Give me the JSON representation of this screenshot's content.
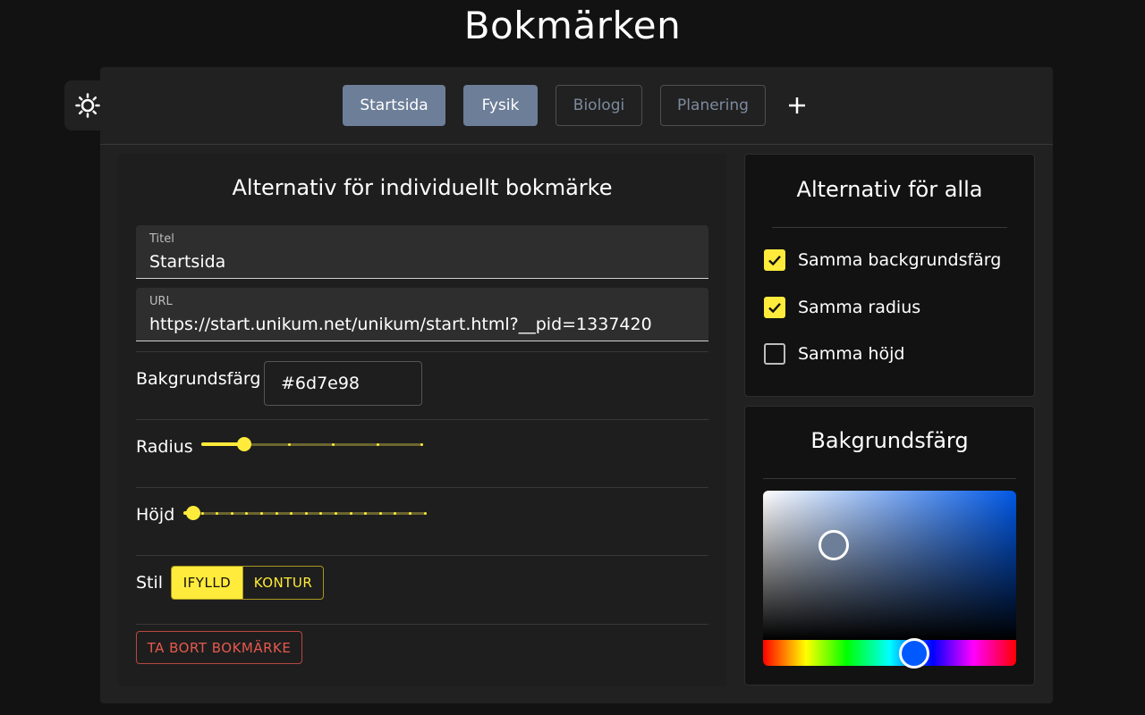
{
  "page": {
    "title": "Bokmärken"
  },
  "theme_toggle": {
    "icon": "sun-icon"
  },
  "tabs": [
    {
      "label": "Startsida",
      "style": "filled"
    },
    {
      "label": "Fysik",
      "style": "filled"
    },
    {
      "label": "Biologi",
      "style": "outline"
    },
    {
      "label": "Planering",
      "style": "outline"
    }
  ],
  "add_tab": {
    "icon": "plus-icon"
  },
  "individual_panel": {
    "title": "Alternativ för individuellt bokmärke",
    "title_field": {
      "label": "Titel",
      "value": "Startsida"
    },
    "url_field": {
      "label": "URL",
      "value": "https://start.unikum.net/unikum/start.html?__pid=1337420"
    },
    "background": {
      "label": "Bakgrundsfärg",
      "value": "#6d7e98"
    },
    "radius": {
      "label": "Radius",
      "value_fraction": 0.2
    },
    "height": {
      "label": "Höjd",
      "value_fraction": 0.05
    },
    "style": {
      "label": "Stil",
      "options": [
        "IFYLLD",
        "KONTUR"
      ],
      "selected": "IFYLLD"
    },
    "delete_label": "TA BORT BOKMÄRKE"
  },
  "all_panel": {
    "title": "Alternativ för alla",
    "options": [
      {
        "label": "Samma backgrundsfärg",
        "checked": true
      },
      {
        "label": "Samma radius",
        "checked": true
      },
      {
        "label": "Samma höjd",
        "checked": false
      }
    ]
  },
  "color_panel": {
    "title": "Bakgrundsfärg",
    "selected_color": "#6d7e98",
    "hue_color": "#0059ff"
  },
  "colors": {
    "accent": "#ffeb3b",
    "tab_active": "#6d7e98",
    "danger": "#e6594e"
  }
}
